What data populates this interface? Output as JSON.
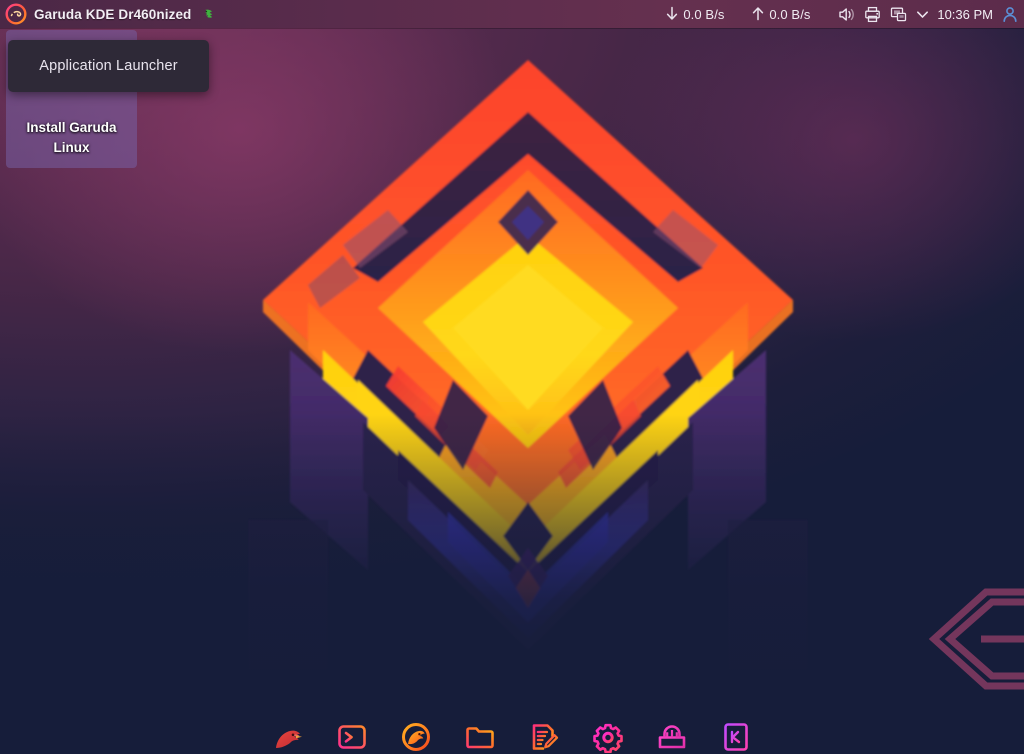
{
  "panel": {
    "logo_icon": "garuda-logo-icon",
    "title": "Garuda KDE Dr460nized",
    "title_badge_icon": "green-dragon-badge-icon",
    "network": {
      "download_icon": "arrow-down-icon",
      "download_speed": "0.0 B/s",
      "upload_icon": "arrow-up-icon",
      "upload_speed": "0.0 B/s"
    },
    "tray": [
      {
        "name": "volume-icon",
        "label": "Volume"
      },
      {
        "name": "printer-icon",
        "label": "Printers"
      },
      {
        "name": "display-icon",
        "label": "Display Configuration"
      },
      {
        "name": "chevron-down-icon",
        "label": "Show hidden icons"
      }
    ],
    "clock": "10:36 PM",
    "user_icon": "user-account-icon"
  },
  "tooltip": {
    "text": "Application Launcher"
  },
  "desktop": {
    "icons": [
      {
        "name": "install-garuda-linux",
        "label": "Install Garuda Linux",
        "icon": "calamares-installer-icon",
        "selected": true
      }
    ]
  },
  "dock": {
    "items": [
      {
        "name": "firedragon-browser",
        "icon": "eagle-head-icon",
        "label": "FireDragon"
      },
      {
        "name": "terminal",
        "icon": "terminal-prompt-icon",
        "label": "Terminal"
      },
      {
        "name": "garuda-browser",
        "icon": "dragon-circle-icon",
        "label": "Browser"
      },
      {
        "name": "file-manager",
        "icon": "folder-icon",
        "label": "File Manager"
      },
      {
        "name": "text-editor",
        "icon": "document-pencil-icon",
        "label": "Text Editor"
      },
      {
        "name": "system-settings",
        "icon": "gear-icon",
        "label": "System Settings"
      },
      {
        "name": "software-center",
        "icon": "shopping-bag-icon",
        "label": "Software Center"
      },
      {
        "name": "kate-editor",
        "icon": "k-letter-box-icon",
        "label": "Kate"
      }
    ]
  },
  "colors": {
    "panel_bg": "#5a2c4c",
    "wallpaper_top": "#61305a",
    "wallpaper_bottom": "#161d3a",
    "accent_pink": "#ff2f7a",
    "accent_orange": "#ff6b2c",
    "accent_yellow": "#ffd21e",
    "selection": "#7661a6",
    "tooltip_bg": "#2e2937",
    "text_primary": "#f2eef4",
    "corner_decor": "#6e3357"
  }
}
